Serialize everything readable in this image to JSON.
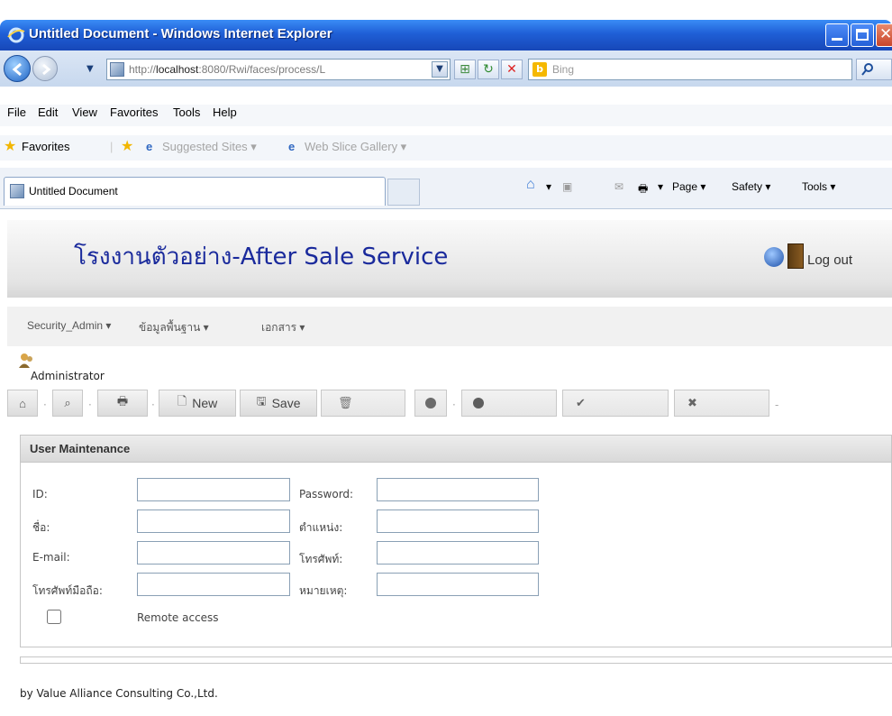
{
  "window": {
    "title": "Untitled Document - Windows Internet Explorer"
  },
  "addressbar": {
    "url_prefix": "http://",
    "url_host": "localhost",
    "url_rest": ":8080/Rwi/faces/process/L",
    "search_placeholder": "Bing"
  },
  "menubar": {
    "items": [
      "File",
      "Edit",
      "View",
      "Favorites",
      "Tools",
      "Help"
    ]
  },
  "favorites": {
    "label": "Favorites",
    "items": [
      "Suggested Sites ▾",
      "Web Slice Gallery ▾"
    ]
  },
  "tabbar": {
    "tab_label": "Untitled Document",
    "commands": [
      "Page ▾",
      "Safety ▾",
      "Tools ▾"
    ]
  },
  "page": {
    "site_title": "โรงงานตัวอย่าง-After Sale Service",
    "logout_label": "Log out",
    "menu": [
      "Security_Admin ▾",
      "ข้อมูลพื้นฐาน ▾",
      "เอกสาร ▾"
    ],
    "user": "Administrator",
    "toolbar": {
      "new_label": "New",
      "save_label": "Save"
    },
    "panel_title": "User Maintenance",
    "form": {
      "id_label": "ID:",
      "password_label": "Password:",
      "name_label": "ชื่อ:",
      "position_label": "ตำแหน่ง:",
      "email_label": "E-mail:",
      "phone_label": "โทรศัพท์:",
      "mobile_label": "โทรศัพท์มือถือ:",
      "note_label": "หมายเหตุ:",
      "remote_label": "Remote access"
    },
    "footer": "by Value Alliance Consulting Co.,Ltd."
  }
}
